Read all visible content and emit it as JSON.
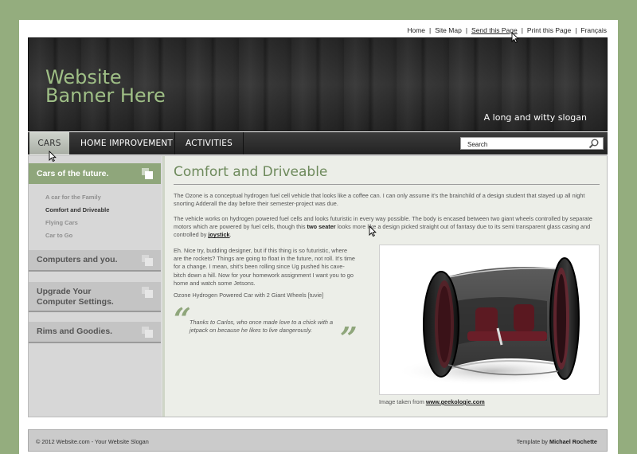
{
  "toplinks": {
    "home": "Home",
    "sitemap": "Site Map",
    "send": "Send this Page",
    "print": "Print this Page",
    "francais": "Français",
    "sep": "|"
  },
  "banner": {
    "title_line1": "Website",
    "title_line2": "Banner Here",
    "slogan": "A long and witty slogan"
  },
  "nav": {
    "items": [
      "CARS",
      "HOME IMPROVEMENT",
      "ACTIVITIES"
    ],
    "search_placeholder": "Search"
  },
  "sidebar": {
    "section1": "Cars of the future.",
    "sub_items": [
      "A car for the Family",
      "Comfort and Driveable",
      "Flying Cars",
      "Car to Go"
    ],
    "section2": "Computers and you.",
    "section3_line1": "Upgrade Your",
    "section3_line2": "Computer Settings.",
    "section4": "Rims and Goodies."
  },
  "content": {
    "title": "Comfort and Driveable",
    "p1": "The Ozone is a conceptual hydrogen fuel cell vehicle that looks like a coffee can. I can only assume it's the brainchild of a design student that stayed up all night snorting Adderall the day before their semester-project was due.",
    "p2_a": "The vehicle works on hydrogen powered fuel cells and looks futuristic in every way possible. The body is encased between two giant wheels controlled by separate motors which are powered by fuel cells, though this ",
    "p2_bold": "two seater",
    "p2_b": " looks more like a design picked straight out of fantasy due to its semi transparent glass casing and controlled by ",
    "p2_link": "joystick",
    "p2_end": ".",
    "p3": "Eh. Nice try, budding designer, but if this thing is so futuristic, where are the rockets? Things are going to float in the future, not roll. It's time for a change. I mean, shit's been rolling since Ug pushed his cave-bitch down a hill. Now for your homework assignment I want you to go home and watch some Jetsons.",
    "p4": "Ozone Hydrogen Powered Car with 2 Giant Wheels [tuvie]",
    "quote": "Thanks to Carlos, who once made love to a chick with a jetpack on because he likes to live dangerously.",
    "quote_open": "“",
    "quote_close": "”",
    "caption_prefix": "Image taken from ",
    "caption_link": "www.geekologie.com"
  },
  "footer": {
    "left": "© 2012 Website.com - Your Website Slogan",
    "right_prefix": "Template by ",
    "right_name": "Michael Rochette"
  },
  "colors": {
    "background": "#94ad7e",
    "accent_green": "#8fa67b",
    "title_green": "#6e8a5c",
    "nav_dark": "#2b2b2b"
  },
  "icons": [
    "search-icon",
    "cursor-icon"
  ]
}
